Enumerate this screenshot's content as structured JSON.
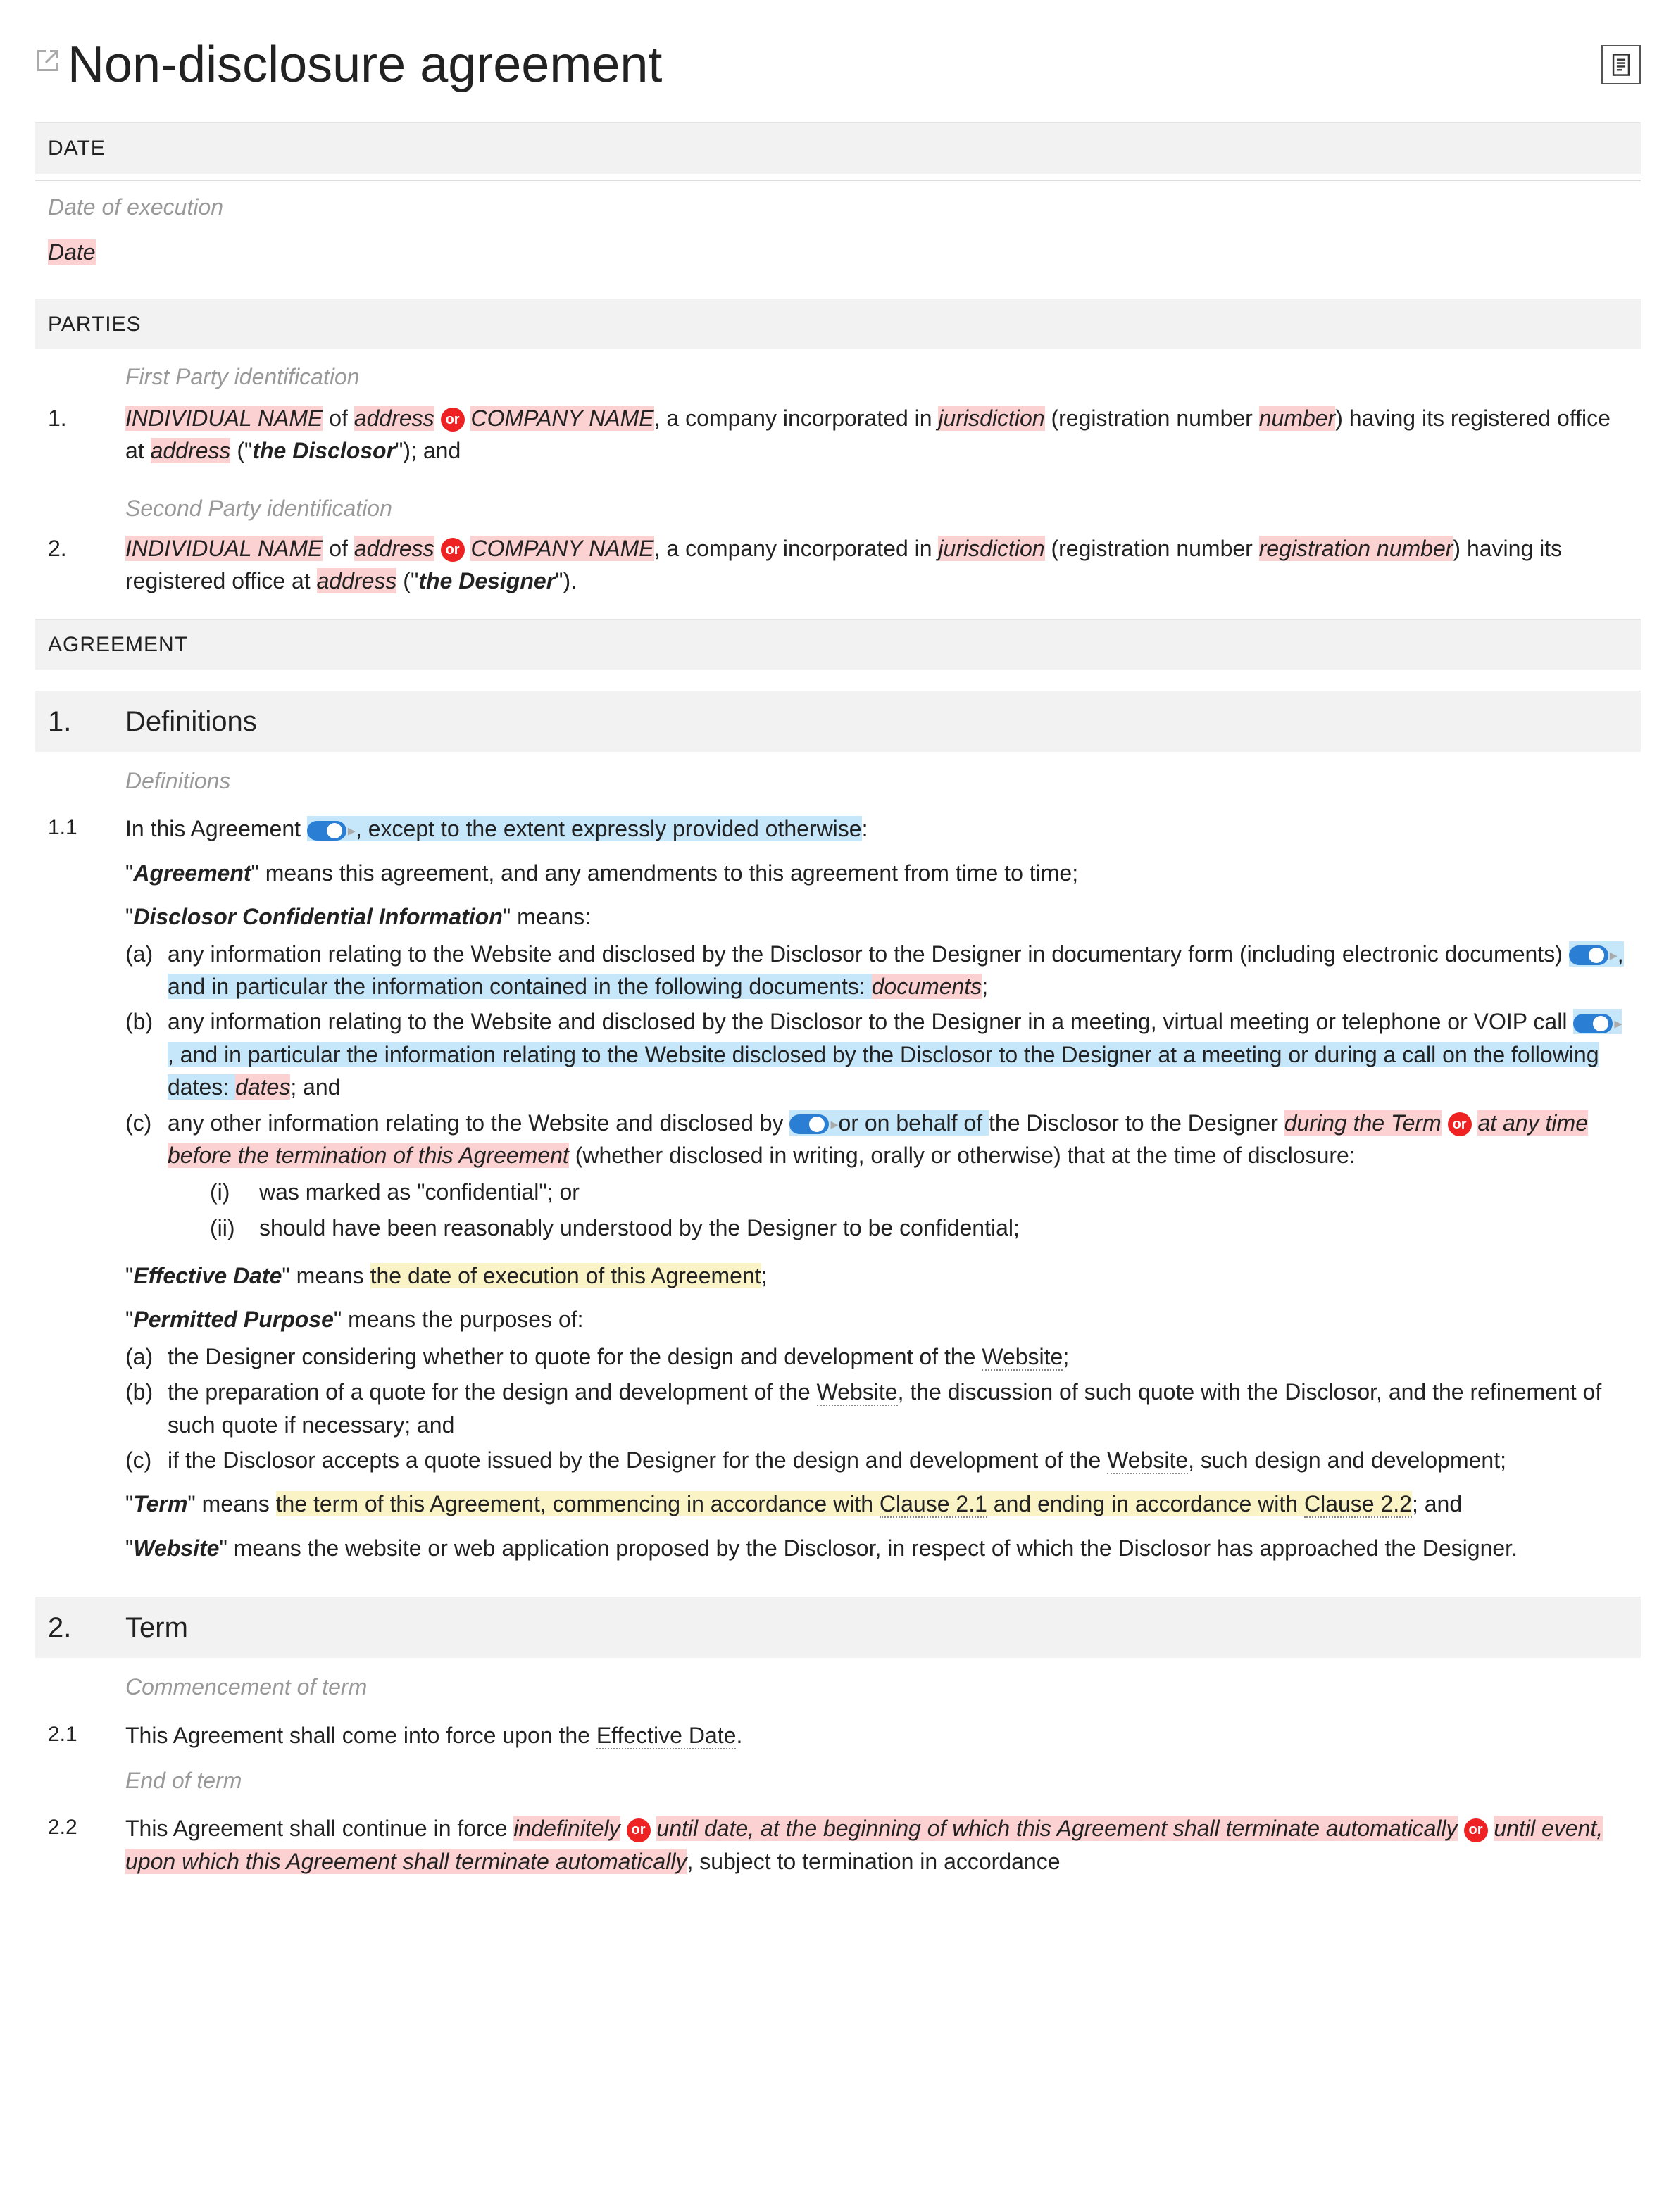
{
  "title": "Non-disclosure agreement",
  "sections": {
    "date": {
      "header": "DATE",
      "label": "Date of execution",
      "value": "Date"
    },
    "parties": {
      "header": "PARTIES",
      "item1": {
        "label": "First Party identification",
        "num": "1.",
        "indiv": "INDIVIDUAL NAME",
        "of1": " of ",
        "addr1": "address",
        "orLabel": "or",
        "company": " COMPANY NAME",
        "t1": ", a company incorporated in ",
        "jur": "jurisdiction",
        "t2": " (registration number ",
        "regnum": "number",
        "t3": ") having its registered office at ",
        "addr2": "address",
        "t4": " (\"",
        "role": "the Disclosor",
        "t5": "\"); and"
      },
      "item2": {
        "label": "Second Party identification",
        "num": "2.",
        "indiv": "INDIVIDUAL NAME",
        "of1": " of ",
        "addr1": "address",
        "orLabel": "or",
        "company": " COMPANY NAME",
        "t1": ", a company incorporated in ",
        "jur": "jurisdiction",
        "t2": " (registration number ",
        "regnum": "registration number",
        "t3": ") having its registered office at ",
        "addr2": "address",
        "t4": " (\"",
        "role": "the Designer",
        "t5": "\")."
      }
    },
    "agreement": {
      "header": "AGREEMENT"
    },
    "def": {
      "num": "1.",
      "title": "Definitions",
      "label": "Definitions",
      "c11num": "1.1",
      "c11a": "In this Agreement",
      "c11b": ", except to the extent expressly provided otherwise",
      "c11c": ":",
      "agr1": "\"",
      "agrTerm": "Agreement",
      "agr2": "\" means this agreement, and any amendments to this agreement from time to time;",
      "dci1": "\"",
      "dciTerm": "Disclosor Confidential Information",
      "dci2": "\" means:",
      "dci_a_mark": "(a)",
      "dci_a_1": "any information relating to the Website and disclosed by the Disclosor to the Designer in documentary form (including electronic documents)",
      "dci_a_2": ", and in particular the information contained in the following documents: ",
      "dci_a_docs": "documents",
      "dci_a_3": ";",
      "dci_b_mark": "(b)",
      "dci_b_1": "any information relating to the Website and disclosed by the Disclosor to the Designer in a meeting, virtual meeting or telephone or VOIP call",
      "dci_b_2": ", and in particular the information relating to the Website disclosed by the Disclosor to the Designer at a meeting or during a call on the following dates: ",
      "dci_b_dates": "dates",
      "dci_b_3": "; and",
      "dci_c_mark": "(c)",
      "dci_c_1": "any other information relating to the Website and disclosed by ",
      "dci_c_2": "or on behalf of ",
      "dci_c_3": "the Disclosor to the Designer ",
      "dci_c_4a": "during the Term",
      "dci_c_or": "or",
      "dci_c_4b": " at any time before the termination of this Agreement",
      "dci_c_5": " (whether disclosed in writing, orally or otherwise) that at the time of disclosure:",
      "dci_c_i_mark": "(i)",
      "dci_c_i": "was marked as \"confidential\"; or",
      "dci_c_ii_mark": "(ii)",
      "dci_c_ii": "should have been reasonably understood by the Designer to be confidential;",
      "eff1": "\"",
      "effTerm": "Effective Date",
      "eff2": "\" means ",
      "eff3": "the date of execution of this Agreement",
      "eff4": ";",
      "pp1": "\"",
      "ppTerm": "Permitted Purpose",
      "pp2": "\" means the purposes of:",
      "pp_a_mark": "(a)",
      "pp_a": "the Designer considering whether to quote for the design and development of the ",
      "pp_a_ws": "Website",
      "pp_a_end": ";",
      "pp_b_mark": "(b)",
      "pp_b_1": "the preparation of a quote for the design and development of the ",
      "pp_b_ws": "Website",
      "pp_b_2": ", the discussion of such quote with the Disclosor, and the refinement of such quote if necessary; and",
      "pp_c_mark": "(c)",
      "pp_c_1": "if the Disclosor accepts a quote issued by the Designer for the design and development of the ",
      "pp_c_ws": "Website",
      "pp_c_2": ", such design and development;",
      "term1": "\"",
      "termTerm": "Term",
      "term2": "\" means ",
      "term3a": "the term of this Agreement, commencing in accordance with ",
      "term3b": "Clause 2.1",
      "term3c": " and ending in accordance with ",
      "term3d": "Clause 2.2",
      "term4": "; and",
      "ws1": "\"",
      "wsTerm": "Website",
      "ws2": "\" means the website or web application proposed by the Disclosor, in respect of which the Disclosor has approached the Designer."
    },
    "term": {
      "num": "2.",
      "title": "Term",
      "label1": "Commencement of term",
      "c21num": "2.1",
      "c21_1": "This Agreement shall come into force upon the ",
      "c21_2": "Effective Date",
      "c21_3": ".",
      "label2": "End of term",
      "c22num": "2.2",
      "c22_1": "This Agreement shall continue in force ",
      "c22_2a": "indefinitely",
      "c22_or1": "or",
      "c22_2b": " until ",
      "c22_date": "date",
      "c22_2c": ", at the beginning of which this Agreement shall terminate automatically",
      "c22_or2": "or",
      "c22_2d": " until ",
      "c22_event": "event",
      "c22_2e": ", upon which this Agreement shall terminate automatically",
      "c22_3": ", subject to termination in accordance"
    }
  }
}
